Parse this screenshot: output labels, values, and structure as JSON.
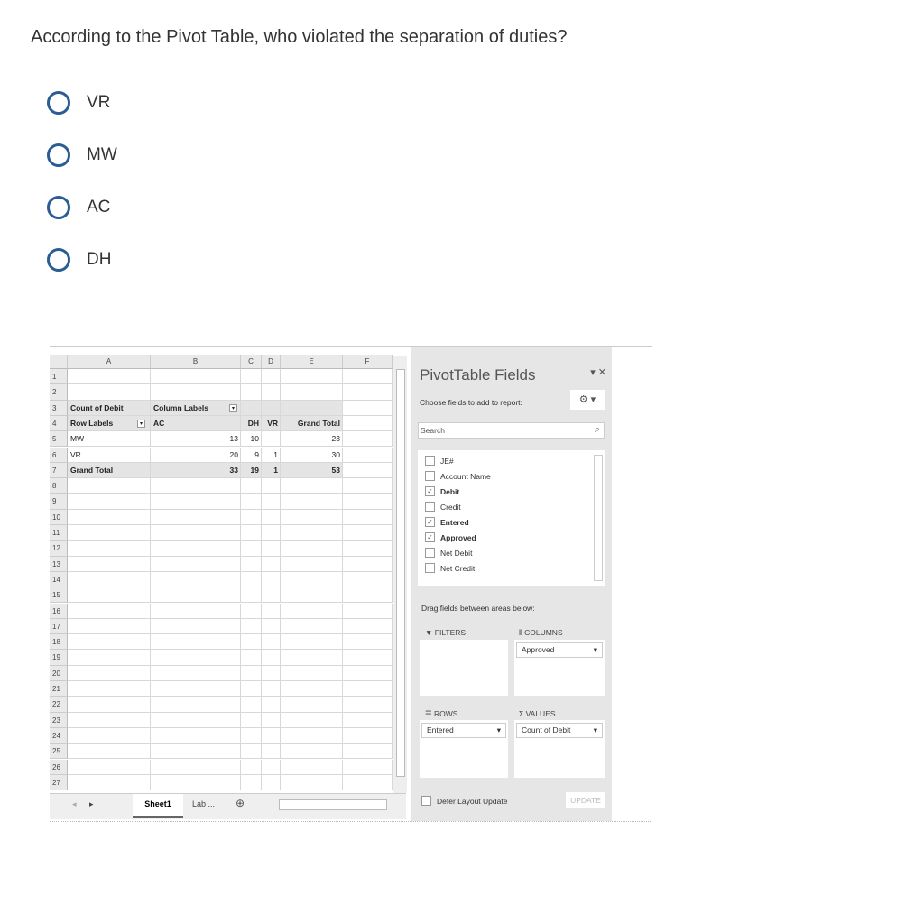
{
  "question": "According to the Pivot Table, who violated the separation of duties?",
  "options": [
    "VR",
    "MW",
    "AC",
    "DH"
  ],
  "accent": "#2a5d93",
  "sheet": {
    "columns": [
      "A",
      "B",
      "C",
      "D",
      "E",
      "F"
    ],
    "row_numbers": [
      1,
      2,
      3,
      4,
      5,
      6,
      7,
      8,
      9,
      10,
      11,
      12,
      13,
      14,
      15,
      16,
      17,
      18,
      19,
      20,
      21,
      22,
      23,
      24,
      25,
      26,
      27
    ],
    "pivot": {
      "r3": [
        "Count of Debit",
        "Column Labels"
      ],
      "r4": [
        "Row Labels",
        "AC",
        "DH",
        "VR",
        "Grand Total"
      ],
      "rows": [
        [
          "MW",
          "13",
          "10",
          "",
          "23"
        ],
        [
          "VR",
          "20",
          "9",
          "1",
          "30"
        ]
      ],
      "total": [
        "Grand Total",
        "33",
        "19",
        "1",
        "53"
      ]
    },
    "tabs": [
      "Sheet1",
      "Lab ..."
    ]
  },
  "panel": {
    "title": "PivotTable Fields",
    "choose": "Choose fields to add to report:",
    "search_placeholder": "Search",
    "fields": [
      {
        "name": "JE#",
        "checked": false
      },
      {
        "name": "Account Name",
        "checked": false
      },
      {
        "name": "Debit",
        "checked": true
      },
      {
        "name": "Credit",
        "checked": false
      },
      {
        "name": "Entered",
        "checked": true
      },
      {
        "name": "Approved",
        "checked": true
      },
      {
        "name": "Net Debit",
        "checked": false
      },
      {
        "name": "Net Credit",
        "checked": false
      }
    ],
    "drag": "Drag fields between areas below:",
    "filters": "FILTERS",
    "columns": "COLUMNS",
    "rows": "ROWS",
    "values": "VALUES",
    "columns_item": "Approved",
    "rows_item": "Entered",
    "values_item": "Count of Debit",
    "defer": "Defer Layout Update",
    "update": "UPDATE"
  }
}
